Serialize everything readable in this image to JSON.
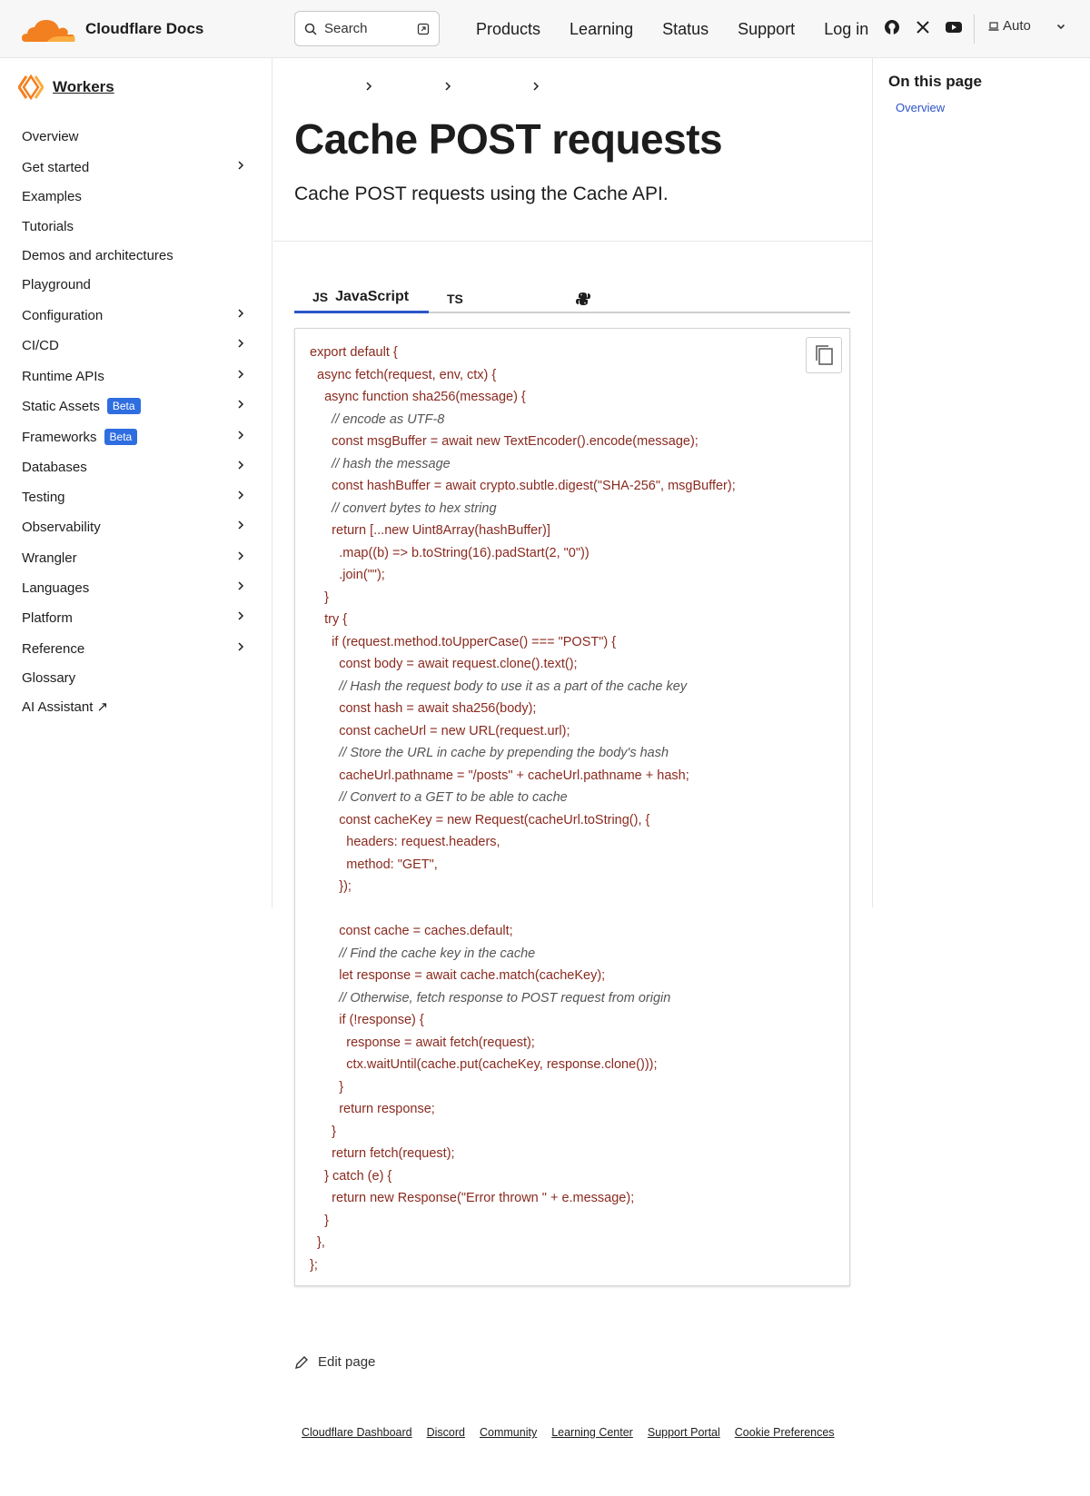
{
  "header": {
    "logo_text": "Cloudflare Docs",
    "search_placeholder": "Search",
    "nav": [
      "Products",
      "Learning",
      "Status",
      "Support",
      "Log in"
    ],
    "theme_label": "Auto",
    "brand_color": "#f38020"
  },
  "sidebar": {
    "title": "Workers",
    "items": [
      {
        "label": "Overview",
        "chevron": false
      },
      {
        "label": "Get started",
        "chevron": true
      },
      {
        "label": "Examples",
        "chevron": false
      },
      {
        "label": "Tutorials",
        "chevron": false
      },
      {
        "label": "Demos and architectures",
        "chevron": false
      },
      {
        "label": "Playground",
        "chevron": false
      },
      {
        "label": "Configuration",
        "chevron": true
      },
      {
        "label": "CI/CD",
        "chevron": true
      },
      {
        "label": "Runtime APIs",
        "chevron": true
      },
      {
        "label": "Static Assets",
        "chevron": true,
        "badge": "Beta"
      },
      {
        "label": "Frameworks",
        "chevron": true,
        "badge": "Beta"
      },
      {
        "label": "Databases",
        "chevron": true
      },
      {
        "label": "Testing",
        "chevron": true
      },
      {
        "label": "Observability",
        "chevron": true
      },
      {
        "label": "Wrangler",
        "chevron": true
      },
      {
        "label": "Languages",
        "chevron": true
      },
      {
        "label": "Platform",
        "chevron": true
      },
      {
        "label": "Reference",
        "chevron": true
      },
      {
        "label": "Glossary",
        "chevron": false
      },
      {
        "label": "AI Assistant ↗",
        "chevron": false
      }
    ]
  },
  "main": {
    "title": "Cache POST requests",
    "description": "Cache POST requests using the Cache API.",
    "tabs": [
      {
        "icon": "JS",
        "label": "JavaScript",
        "active": true
      },
      {
        "icon": "TS",
        "label": "",
        "active": false
      },
      {
        "icon": "python-icon",
        "label": "",
        "active": false
      }
    ],
    "code_lines": [
      "export default {",
      "  async fetch(request, env, ctx) {",
      "    async function sha256(message) {",
      "      // encode as UTF-8",
      "      const msgBuffer = await new TextEncoder().encode(message);",
      "      // hash the message",
      "      const hashBuffer = await crypto.subtle.digest(\"SHA-256\", msgBuffer);",
      "      // convert bytes to hex string",
      "      return [...new Uint8Array(hashBuffer)]",
      "        .map((b) => b.toString(16).padStart(2, \"0\"))",
      "        .join(\"\");",
      "    }",
      "    try {",
      "      if (request.method.toUpperCase() === \"POST\") {",
      "        const body = await request.clone().text();",
      "        // Hash the request body to use it as a part of the cache key",
      "        const hash = await sha256(body);",
      "        const cacheUrl = new URL(request.url);",
      "        // Store the URL in cache by prepending the body's hash",
      "        cacheUrl.pathname = \"/posts\" + cacheUrl.pathname + hash;",
      "        // Convert to a GET to be able to cache",
      "        const cacheKey = new Request(cacheUrl.toString(), {",
      "          headers: request.headers,",
      "          method: \"GET\",",
      "        });",
      "",
      "        const cache = caches.default;",
      "        // Find the cache key in the cache",
      "        let response = await cache.match(cacheKey);",
      "        // Otherwise, fetch response to POST request from origin",
      "        if (!response) {",
      "          response = await fetch(request);",
      "          ctx.waitUntil(cache.put(cacheKey, response.clone()));",
      "        }",
      "        return response;",
      "      }",
      "      return fetch(request);",
      "    } catch (e) {",
      "      return new Response(\"Error thrown \" + e.message);",
      "    }",
      "  },",
      "};"
    ],
    "edit_label": "Edit page"
  },
  "footer": {
    "links": [
      "Cloudflare Dashboard",
      "Discord",
      "Community",
      "Learning Center",
      "Support Portal",
      "Cookie Preferences"
    ]
  },
  "toc": {
    "title": "On this page",
    "links": [
      "Overview"
    ]
  }
}
